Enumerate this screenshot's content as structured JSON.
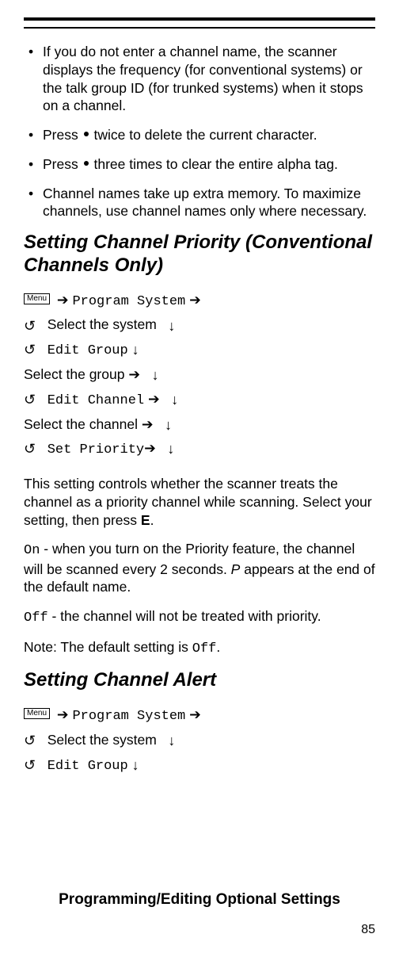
{
  "bullets": [
    {
      "pre": "If you do not enter a channel name, the scanner displays the frequency (for conventional systems) or the talk group ID (for trunked systems) when it stops on a channel."
    },
    {
      "press_twice_a": "Press ",
      "press_twice_b": " twice to delete the current character."
    },
    {
      "press_three_a": "Press ",
      "press_three_b": " three times to clear the entire alpha tag."
    },
    {
      "memory": "Channel names take up extra memory. To maximize channels, use channel names only where necessary."
    }
  ],
  "heading1": "Setting Channel Priority (Conventional Channels Only)",
  "nav1": {
    "menu_label": "Menu",
    "program_system": "Program System",
    "select_system": "Select the system",
    "edit_group": "Edit Group",
    "select_group": "Select the group",
    "edit_channel": "Edit Channel",
    "select_channel": "Select the channel",
    "set_priority": "Set Priority"
  },
  "para1": "This setting controls whether the scanner treats the channel as a priority channel while scanning. Select your setting, then press ",
  "para1_bold": "E",
  "para1_end": ".",
  "on_label": "On",
  "on_text": " - when you turn on the Priority feature, the channel will be scanned every 2 seconds. ",
  "on_italic": "P",
  "on_text2": " appears at the end of the default name.",
  "off_label": "Off",
  "off_text": " - the channel will not be treated with priority.",
  "note": "Note: The default setting is ",
  "note_off": "Off",
  "note_end": ".",
  "heading2": "Setting Channel Alert",
  "nav2": {
    "menu_label": "Menu",
    "program_system": "Program System",
    "select_system": "Select the system",
    "edit_group": "Edit Group"
  },
  "footer": "Programming/Editing Optional Settings",
  "page": "85"
}
